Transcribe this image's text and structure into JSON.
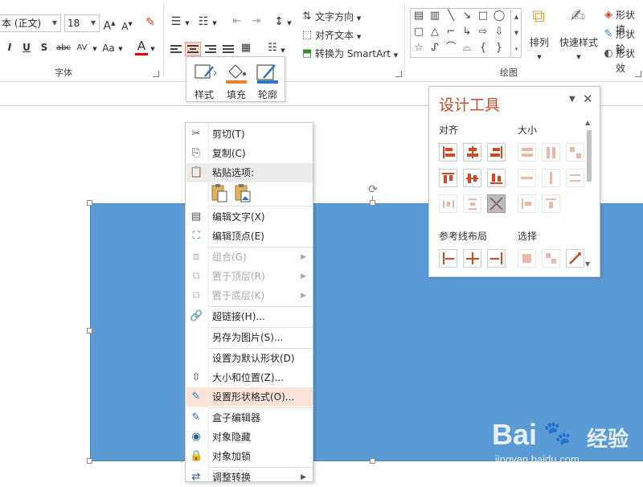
{
  "ribbon": {
    "font_name": "本 (正文)",
    "font_size": "18",
    "text_direction": "文字方向",
    "align_text": "对齐文本",
    "convert_smartart": "转换为 SmartArt",
    "arrange": "排列",
    "quick_styles": "快速样式",
    "shape_fill": "形状填",
    "shape_outline": "形状轮",
    "shape_effects": "形状效",
    "group_font": "字体",
    "group_drawing": "绘图",
    "grow_font": "A",
    "shrink_font": "A",
    "italic": "I",
    "underline": "U",
    "strike": "S",
    "strikethrough": "abc",
    "spacing": "AV",
    "change_case": "Aa",
    "font_color": "A"
  },
  "mini_toolbar": {
    "style": "样式",
    "fill": "填充",
    "outline": "轮廓"
  },
  "context_menu": {
    "items": [
      {
        "label": "剪切(T)",
        "icon": "scissors-icon"
      },
      {
        "label": "复制(C)",
        "icon": "copy-icon"
      },
      {
        "label": "粘贴选项:",
        "icon": "paste-icon"
      },
      {
        "label": "编辑文字(X)",
        "icon": "edit-text-icon"
      },
      {
        "label": "编辑顶点(E)",
        "icon": "edit-points-icon"
      },
      {
        "label": "组合(G)",
        "icon": "group-icon"
      },
      {
        "label": "置于顶层(R)",
        "icon": "bring-front-icon"
      },
      {
        "label": "置于底层(K)",
        "icon": "send-back-icon"
      },
      {
        "label": "超链接(H)...",
        "icon": "hyperlink-icon"
      },
      {
        "label": "另存为图片(S)...",
        "icon": ""
      },
      {
        "label": "设置为默认形状(D)",
        "icon": ""
      },
      {
        "label": "大小和位置(Z)...",
        "icon": "size-position-icon"
      },
      {
        "label": "设置形状格式(O)...",
        "icon": "format-shape-icon"
      },
      {
        "label": "盒子编辑器",
        "icon": "box-editor-icon"
      },
      {
        "label": "对象隐藏",
        "icon": "hide-object-icon"
      },
      {
        "label": "对象加锁",
        "icon": "lock-icon"
      },
      {
        "label": "调整转换",
        "icon": "convert-icon"
      }
    ]
  },
  "design_pane": {
    "title": "设计工具",
    "section_align": "对齐",
    "section_size": "大小",
    "section_guides": "参考线布局",
    "section_select": "选择"
  },
  "watermark": {
    "brand": "Bai",
    "brand_cn": "经验",
    "url": "jingyan.baidu.com"
  },
  "colors": {
    "accent": "#d24726",
    "shape_fill": "#5b9bd5",
    "menu_highlight": "#fde4d9"
  }
}
